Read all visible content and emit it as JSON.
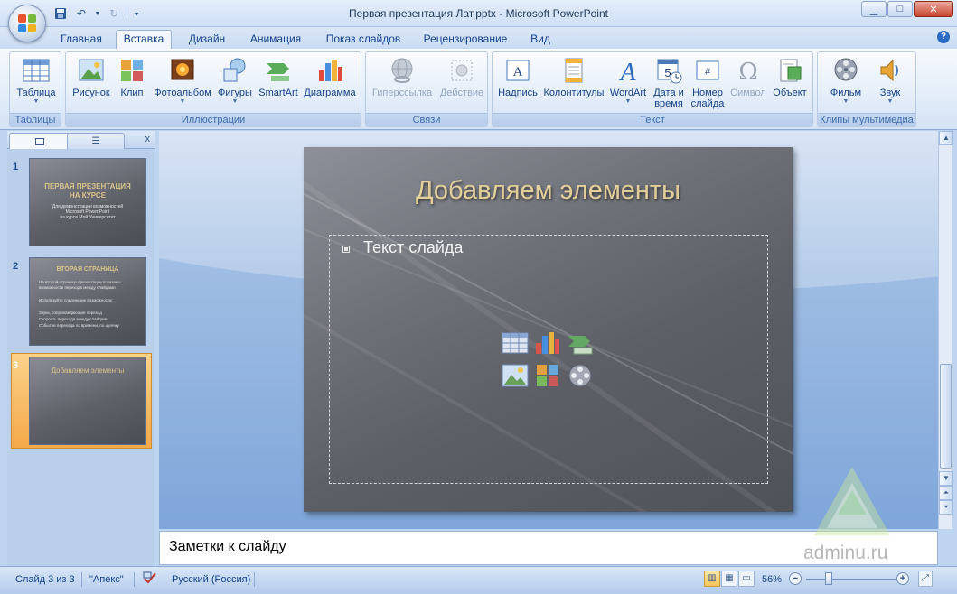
{
  "window": {
    "title": "Первая презентация Лат.pptx - Microsoft PowerPoint"
  },
  "tabs": [
    {
      "label": "Главная",
      "active": false
    },
    {
      "label": "Вставка",
      "active": true
    },
    {
      "label": "Дизайн",
      "active": false
    },
    {
      "label": "Анимация",
      "active": false
    },
    {
      "label": "Показ слайдов",
      "active": false
    },
    {
      "label": "Рецензирование",
      "active": false
    },
    {
      "label": "Вид",
      "active": false
    }
  ],
  "ribbon": {
    "groups": {
      "tables": {
        "label": "Таблицы",
        "buttons": {
          "table": "Таблица"
        }
      },
      "illustrations": {
        "label": "Иллюстрации",
        "buttons": {
          "picture": "Рисунок",
          "clip": "Клип",
          "photoalbum": "Фотоальбом",
          "shapes": "Фигуры",
          "smartart": "SmartArt",
          "chart": "Диаграмма"
        }
      },
      "links": {
        "label": "Связи",
        "buttons": {
          "hyperlink": "Гиперссылка",
          "action": "Действие"
        }
      },
      "text": {
        "label": "Текст",
        "buttons": {
          "textbox": "Надпись",
          "headerfooter": "Колонтитулы",
          "wordart": "WordArt",
          "datetime_1": "Дата и",
          "datetime_2": "время",
          "slidenum_1": "Номер",
          "slidenum_2": "слайда",
          "symbol": "Символ",
          "object": "Объект"
        }
      },
      "media": {
        "label": "Клипы мультимедиа",
        "buttons": {
          "movie": "Фильм",
          "sound": "Звук"
        }
      }
    }
  },
  "slides_panel": {
    "slides": [
      {
        "number": "1",
        "title_1": "ПЕРВАЯ ПРЕЗЕНТАЦИЯ",
        "title_2": "НА КУРСЕ",
        "sub_1": "Для демонстрации возможностей",
        "sub_2": "Microsoft Power Point",
        "sub_3": "на курсе Мой Университет"
      },
      {
        "number": "2",
        "title": "ВТОРАЯ СТРАНИЦА",
        "bullets": [
          "На второй странице презентации показаны",
          "возможности перехода между слайдами",
          "Используйте следующие возможности:",
          "Звуки, сопровождающие переход",
          "Скорость перехода между слайдами",
          "Событие перехода по времени, по щелчку"
        ]
      },
      {
        "number": "3",
        "title": "Добавляем элементы",
        "selected": true
      }
    ]
  },
  "slide": {
    "title": "Добавляем элементы",
    "placeholder_text": "Текст слайда"
  },
  "notes": {
    "text": "Заметки к слайду"
  },
  "status": {
    "slide_info": "Слайд 3 из 3",
    "theme": "\"Апекс\"",
    "language": "Русский (Россия)",
    "zoom": "56%"
  },
  "watermark": {
    "text": "adminu.ru"
  }
}
